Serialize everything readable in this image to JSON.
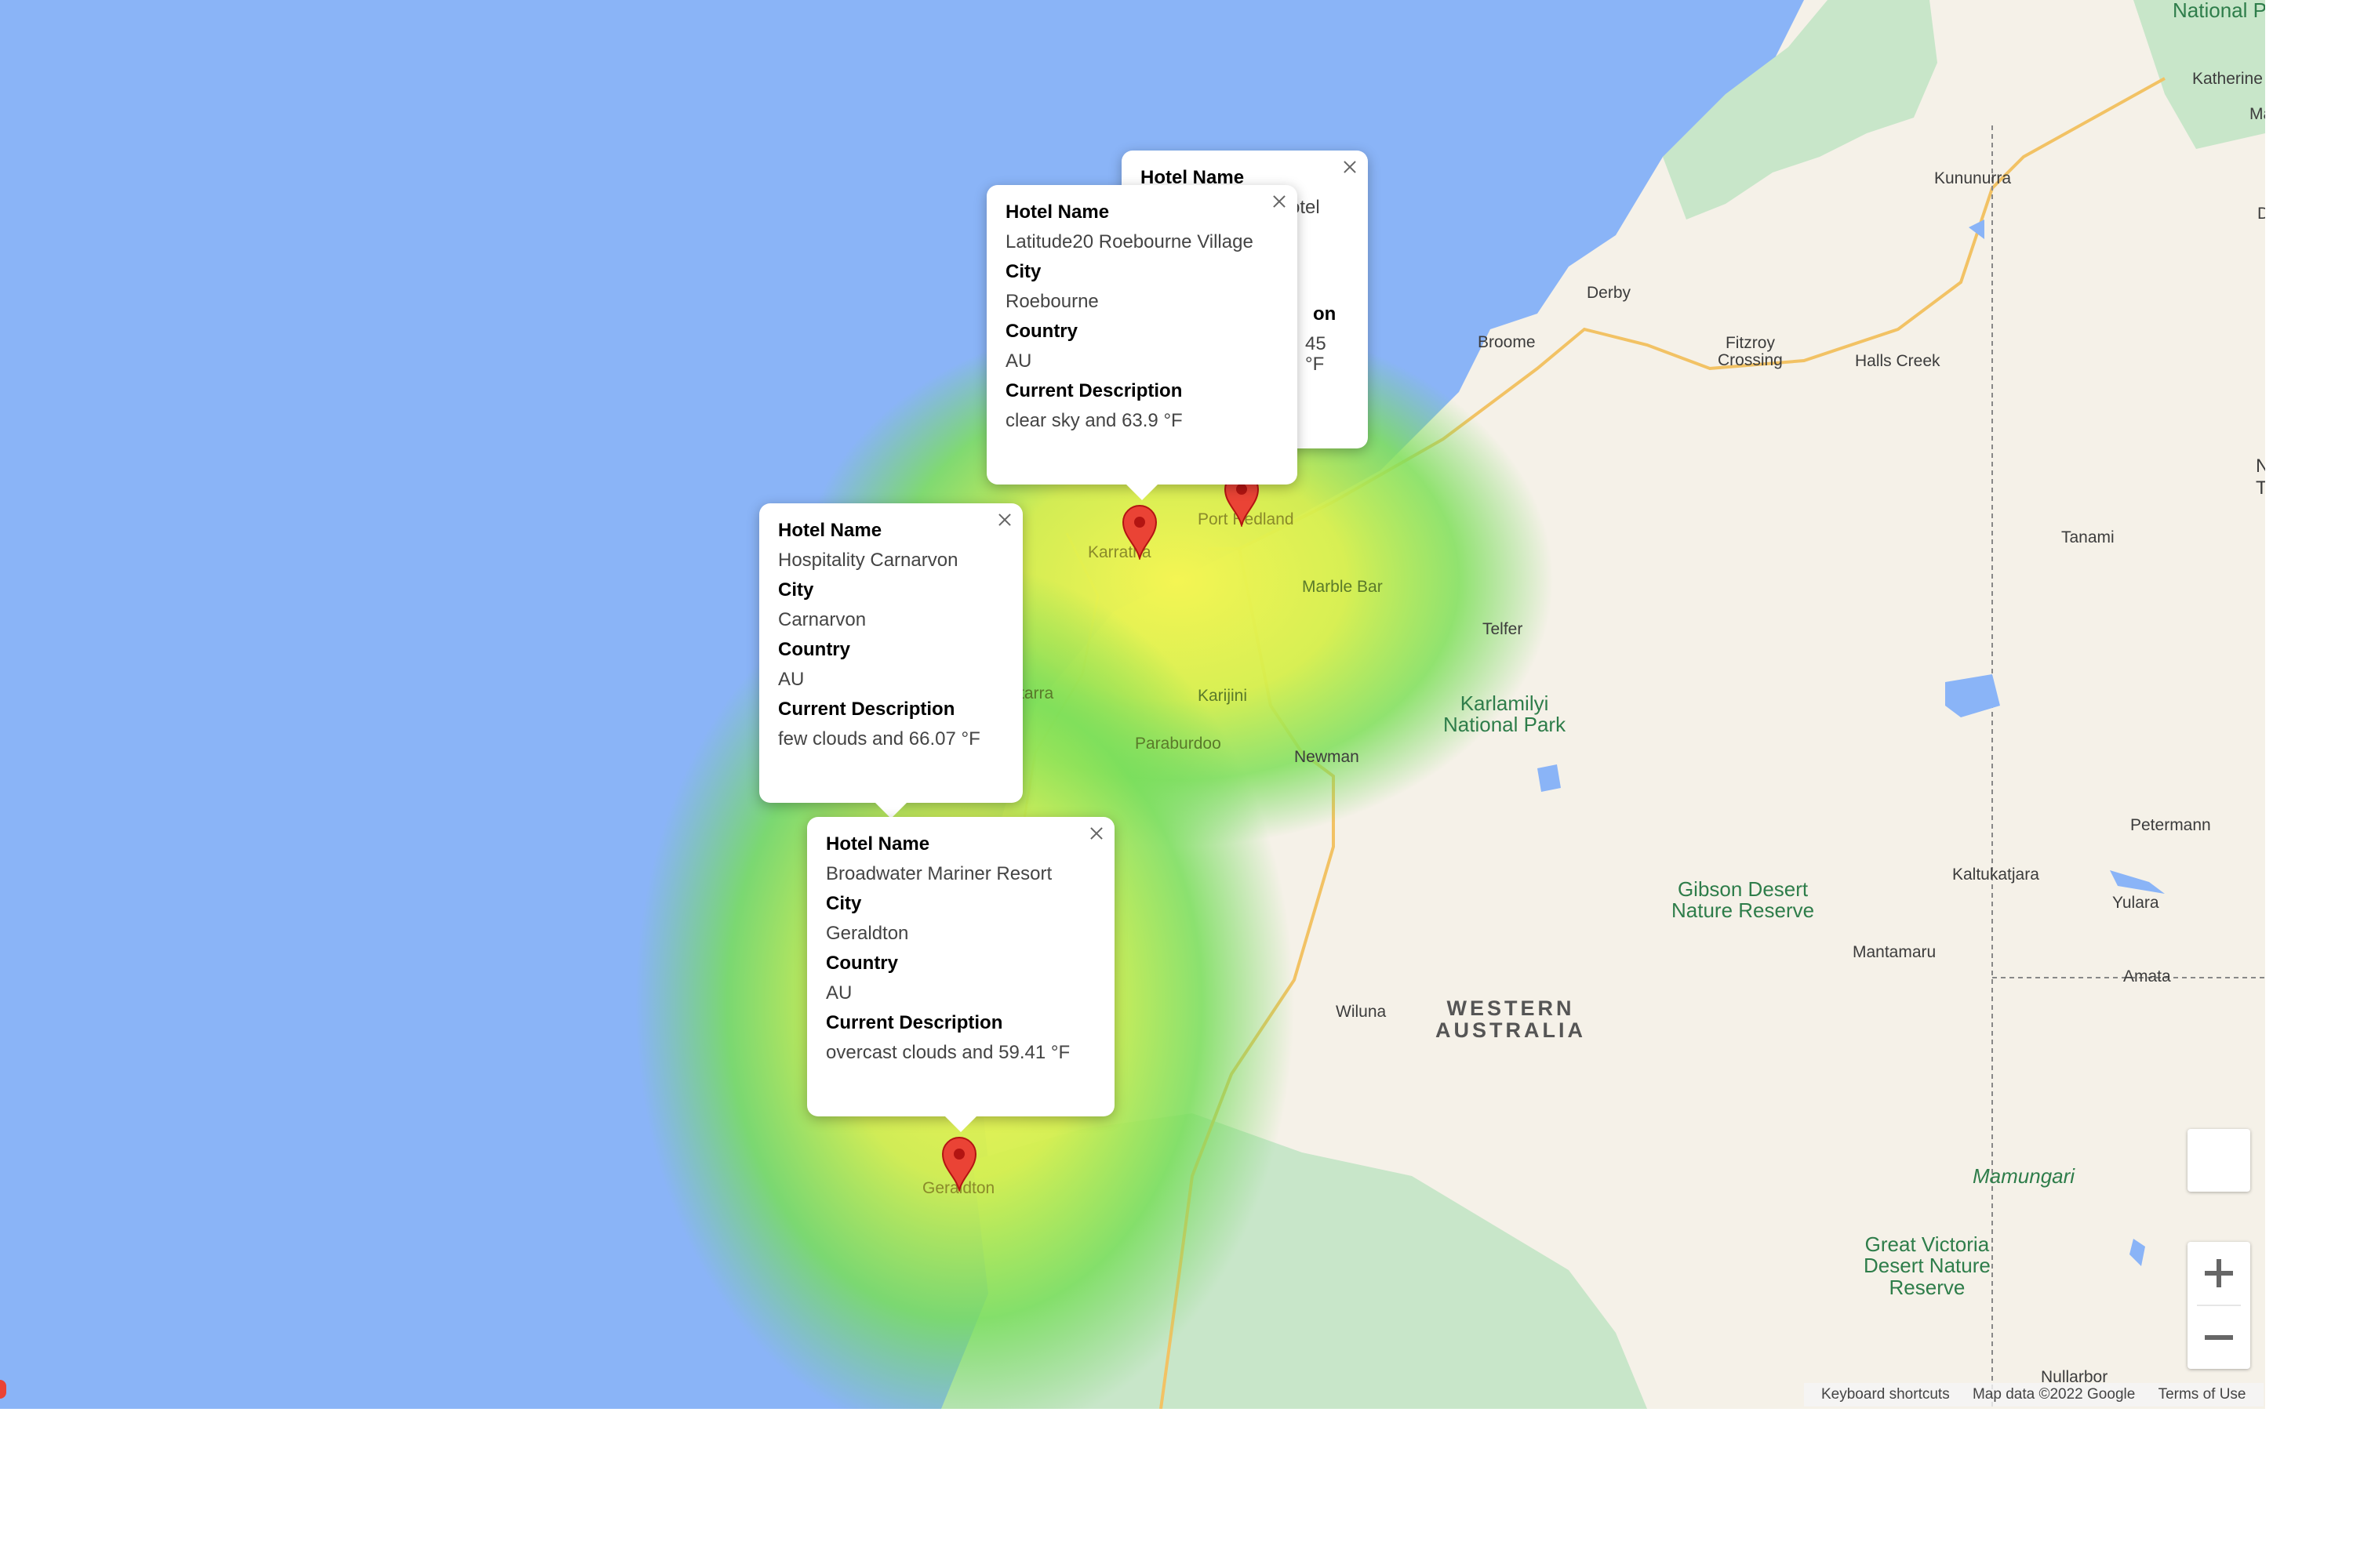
{
  "map": {
    "colors": {
      "water": "#8ab4f7",
      "land": "#f5f1e8",
      "park": "#c5e8c5",
      "road": "#f2c264",
      "marker": "#ea4335"
    },
    "labels": {
      "national_partial": "National P",
      "katherine": "Katherine",
      "ma_partial": "Ma",
      "d_partial": "D",
      "kununurra": "Kununurra",
      "derby": "Derby",
      "broome": "Broome",
      "fitzroy_crossing": "Fitzroy\nCrossing",
      "halls_creek": "Halls Creek",
      "n_partial": "N",
      "t_partial": "T",
      "tanami": "Tanami",
      "port_hedland": "Port Hedland",
      "karratha": "Karratha",
      "marble_bar": "Marble Bar",
      "telfer": "Telfer",
      "karlamilyi": "Karlamilyi\nNational Park",
      "tarra_partial": "tarra",
      "karijini": "Karijini",
      "paraburdoo": "Paraburdoo",
      "newman": "Newman",
      "petermann": "Petermann",
      "gibson": "Gibson Desert\nNature Reserve",
      "kaltukatjara": "Kaltukatjara",
      "yulara": "Yulara",
      "mantamaru": "Mantamaru",
      "amata": "Amata",
      "wiluna": "Wiluna",
      "western_australia": "WESTERN\nAUSTRALIA",
      "geraldton": "Geraldton",
      "mamungari": "Mamungari",
      "great_victoria": "Great Victoria\nDesert Nature\nReserve",
      "nullarbor": "Nullarbor"
    },
    "info_windows": [
      {
        "hotel_name_label": "Hotel Name",
        "hotel_name": "",
        "hotel_name_partial": "Hotel Name",
        "hotel_fragment": "otel",
        "desc_fragment_label": "on",
        "desc_fragment": "45 °F"
      },
      {
        "hotel_name_label": "Hotel Name",
        "hotel_name": "Latitude20 Roebourne Village",
        "city_label": "City",
        "city": "Roebourne",
        "country_label": "Country",
        "country": "AU",
        "desc_label": "Current Description",
        "desc": "clear sky and 63.9 °F"
      },
      {
        "hotel_name_label": "Hotel Name",
        "hotel_name": "Hospitality Carnarvon",
        "city_label": "City",
        "city": "Carnarvon",
        "country_label": "Country",
        "country": "AU",
        "desc_label": "Current Description",
        "desc": "few clouds and 66.07 °F"
      },
      {
        "hotel_name_label": "Hotel Name",
        "hotel_name": "Broadwater Mariner Resort",
        "city_label": "City",
        "city": "Geraldton",
        "country_label": "Country",
        "country": "AU",
        "desc_label": "Current Description",
        "desc": "overcast clouds and 59.41 °F"
      }
    ],
    "markers": [
      "marker-icon",
      "marker-icon",
      "marker-icon"
    ],
    "controls": {
      "zoom_in_icon": "plus-icon",
      "zoom_out_icon": "minus-icon",
      "pegman_icon": "street-view-icon"
    },
    "attribution": {
      "keyboard": "Keyboard shortcuts",
      "map_data": "Map data ©2022 Google",
      "terms": "Terms of Use"
    }
  }
}
